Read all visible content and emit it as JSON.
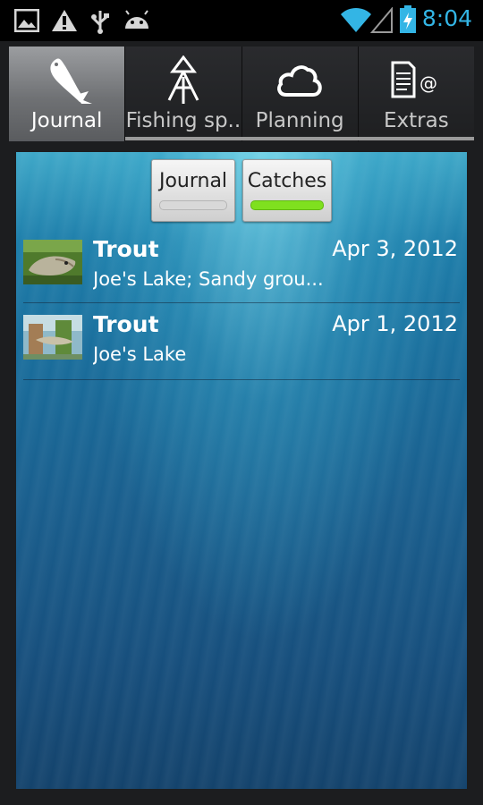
{
  "status_bar": {
    "time": "8:04",
    "icons_left": [
      "image-icon",
      "alert-icon",
      "usb-icon",
      "android-icon"
    ],
    "icons_right": [
      "wifi-icon",
      "signal-icon",
      "battery-icon"
    ],
    "accent_color": "#33b5e5"
  },
  "tabs": [
    {
      "label": "Journal",
      "icon": "fish-icon",
      "active": true
    },
    {
      "label": "Fishing sp..",
      "icon": "fishing-spot-icon",
      "active": false
    },
    {
      "label": "Planning",
      "icon": "cloud-icon",
      "active": false
    },
    {
      "label": "Extras",
      "icon": "document-at-icon",
      "active": false
    }
  ],
  "segment": {
    "journal_label": "Journal",
    "catches_label": "Catches",
    "selected": "Catches",
    "indicator_color": "#7fe01f"
  },
  "entries": [
    {
      "title": "Trout",
      "date": "Apr 3, 2012",
      "subtitle": "Joe's Lake; Sandy grou..."
    },
    {
      "title": "Trout",
      "date": "Apr 1, 2012",
      "subtitle": "Joe's Lake"
    }
  ]
}
